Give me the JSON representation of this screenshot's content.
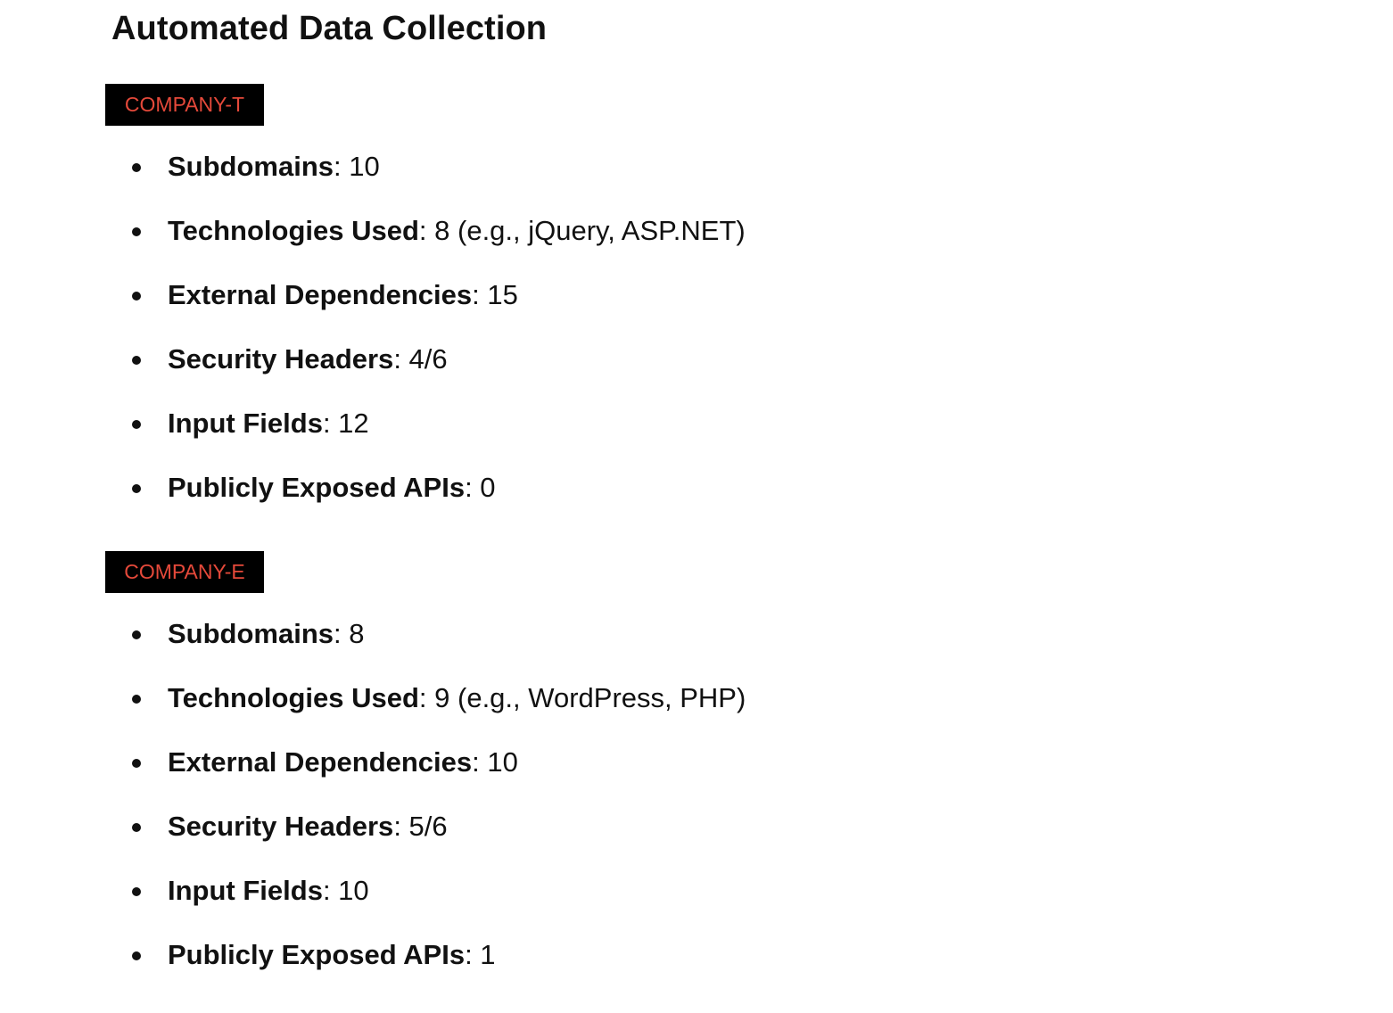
{
  "page": {
    "title": "Automated Data Collection"
  },
  "colors": {
    "badge_background": "#000000",
    "badge_text": "#e5493a",
    "text": "#111111"
  },
  "companies": [
    {
      "name": "COMPANY-T",
      "stats": [
        {
          "label": "Subdomains",
          "value": ": 10"
        },
        {
          "label": "Technologies Used",
          "value": ": 8 (e.g., jQuery, ASP.NET)"
        },
        {
          "label": "External Dependencies",
          "value": ": 15"
        },
        {
          "label": "Security Headers",
          "value": ": 4/6"
        },
        {
          "label": "Input Fields",
          "value": ": 12"
        },
        {
          "label": "Publicly Exposed APIs",
          "value": ": 0"
        }
      ]
    },
    {
      "name": "COMPANY-E",
      "stats": [
        {
          "label": "Subdomains",
          "value": ": 8"
        },
        {
          "label": "Technologies Used",
          "value": ": 9 (e.g., WordPress, PHP)"
        },
        {
          "label": "External Dependencies",
          "value": ": 10"
        },
        {
          "label": "Security Headers",
          "value": ": 5/6"
        },
        {
          "label": "Input Fields",
          "value": ": 10"
        },
        {
          "label": "Publicly Exposed APIs",
          "value": ": 1"
        }
      ]
    }
  ]
}
